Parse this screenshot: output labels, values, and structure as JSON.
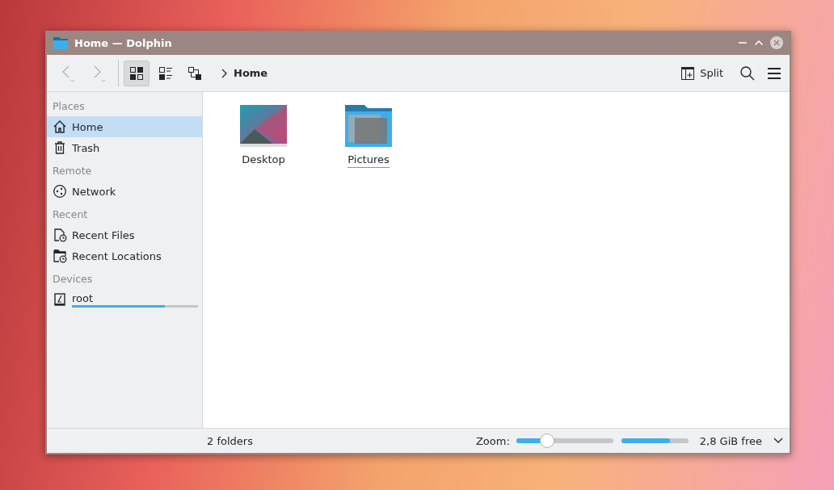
{
  "window": {
    "title": "Home — Dolphin"
  },
  "toolbar": {
    "back": {
      "disabled": true
    },
    "forward": {
      "disabled": true
    },
    "view_modes": [
      {
        "kind": "icons",
        "selected": true
      },
      {
        "kind": "compact",
        "selected": false
      },
      {
        "kind": "details",
        "selected": false
      }
    ],
    "breadcrumb": [
      "Home"
    ],
    "split": "Split"
  },
  "sidebar": {
    "sections": [
      {
        "title": "Places",
        "items": [
          {
            "kind": "home",
            "label": "Home",
            "selected": true
          },
          {
            "kind": "trash",
            "label": "Trash",
            "selected": false
          }
        ]
      },
      {
        "title": "Remote",
        "items": [
          {
            "kind": "network",
            "label": "Network",
            "selected": false
          }
        ]
      },
      {
        "title": "Recent",
        "items": [
          {
            "kind": "recent-files",
            "label": "Recent Files",
            "selected": false
          },
          {
            "kind": "recent-locations",
            "label": "Recent Locations",
            "selected": false
          }
        ]
      },
      {
        "title": "Devices",
        "items": [
          {
            "kind": "drive",
            "label": "root",
            "selected": false,
            "level": 0.74
          }
        ]
      }
    ]
  },
  "files": [
    {
      "kind": "desktop",
      "name": "Desktop",
      "focused": false
    },
    {
      "kind": "pictures",
      "name": "Pictures",
      "focused": true
    }
  ],
  "status_bar": {
    "summary": "2 folders",
    "zoom_label": "Zoom:",
    "zoom": {
      "level": 0.29
    },
    "space": {
      "level": 0.73
    },
    "free": "2,8 GiB free"
  }
}
